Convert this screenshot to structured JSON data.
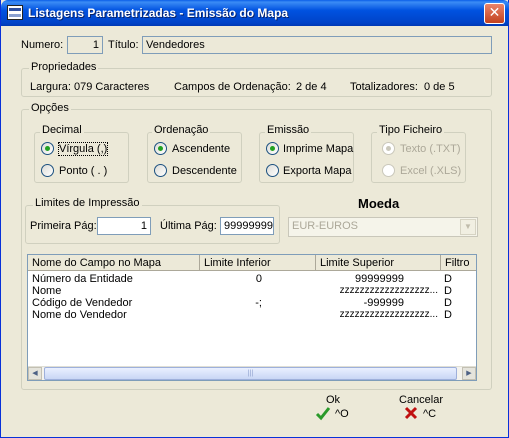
{
  "window": {
    "title": "Listagens Parametrizadas - Emissão do Mapa",
    "close": "✕"
  },
  "header": {
    "numero_label": "Numero:",
    "numero_value": "1",
    "titulo_label": "Título:",
    "titulo_value": "Vendedores"
  },
  "propriedades": {
    "title": "Propriedades",
    "largura": "Largura: 079 Caracteres",
    "campos_label": "Campos de Ordenação:",
    "campos_value": "2 de 4",
    "totalizadores_label": "Totalizadores:",
    "totalizadores_value": "0 de 5"
  },
  "opcoes": {
    "title": "Opções",
    "decimal": {
      "title": "Decimal",
      "opt1": "Vírgula (,)",
      "opt2": "Ponto ( . )"
    },
    "ordenacao": {
      "title": "Ordenação",
      "opt1": "Ascendente",
      "opt2": "Descendente"
    },
    "emissao": {
      "title": "Emissão",
      "opt1": "Imprime Mapa",
      "opt2": "Exporta Mapa"
    },
    "tipo_ficheiro": {
      "title": "Tipo Ficheiro",
      "opt1": "Texto (.TXT)",
      "opt2": "Excel (.XLS)"
    },
    "limites": {
      "title": "Limites de Impressão",
      "primeira_label": "Primeira Pág:",
      "primeira_value": "1",
      "ultima_label": "Última Pág:",
      "ultima_value": "99999999"
    },
    "moeda": {
      "title": "Moeda",
      "value": "EUR-EUROS"
    }
  },
  "grid": {
    "columns": [
      "Nome do Campo no Mapa",
      "Limite Inferior",
      "Limite Superior",
      "Filtro"
    ],
    "rows": [
      [
        "Número da Entidade",
        "0",
        "99999999",
        "D"
      ],
      [
        "Nome",
        "",
        "zzzzzzzzzzzzzzzzzz...",
        "D"
      ],
      [
        "Código de Vendedor",
        "-;",
        "-999999",
        "D"
      ],
      [
        "Nome do Vendedor",
        "",
        "zzzzzzzzzzzzzzzzzz...",
        "D"
      ]
    ]
  },
  "buttons": {
    "ok_label": "Ok",
    "ok_shortcut": "^O",
    "cancel_label": "Cancelar",
    "cancel_shortcut": "^C"
  },
  "colors": {
    "accent_ok": "#2a9a2a",
    "accent_cancel": "#c01010",
    "title_bar": "#0052e0"
  }
}
